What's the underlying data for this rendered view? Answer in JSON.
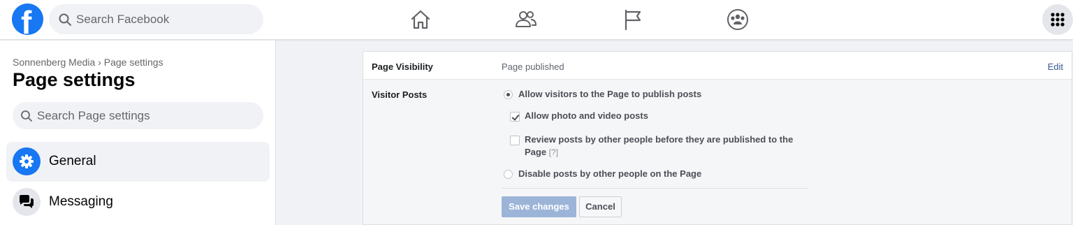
{
  "topbar": {
    "logo_letter": "f",
    "search_placeholder": "Search Facebook",
    "nav_icons": [
      "home-icon",
      "friends-icon",
      "pages-flag-icon",
      "groups-icon"
    ],
    "menu_icon": "grid-menu-icon"
  },
  "sidebar": {
    "breadcrumb": "Sonnenberg Media › Page settings",
    "title": "Page settings",
    "search_placeholder": "Search Page settings",
    "items": [
      {
        "label": "General",
        "icon": "gear-icon",
        "active": true
      },
      {
        "label": "Messaging",
        "icon": "chat-bubbles-icon",
        "active": false
      }
    ]
  },
  "settings": {
    "visibility": {
      "label": "Page Visibility",
      "value": "Page published",
      "edit_label": "Edit"
    },
    "visitor_posts": {
      "label": "Visitor Posts",
      "option_allow": "Allow visitors to the Page to publish posts",
      "sub_photo_video": "Allow photo and video posts",
      "sub_review_line1": "Review posts by other people before they are published to the",
      "sub_review_line2": "Page",
      "sub_review_help": "[?]",
      "option_disable": "Disable posts by other people on the Page",
      "states": {
        "allow_selected": true,
        "photo_video_checked": true,
        "review_checked": false,
        "disable_selected": false
      }
    },
    "save_label": "Save changes",
    "cancel_label": "Cancel"
  },
  "colors": {
    "brand": "#1877f2",
    "link": "#385898",
    "save_disabled": "#9cb4d8"
  }
}
